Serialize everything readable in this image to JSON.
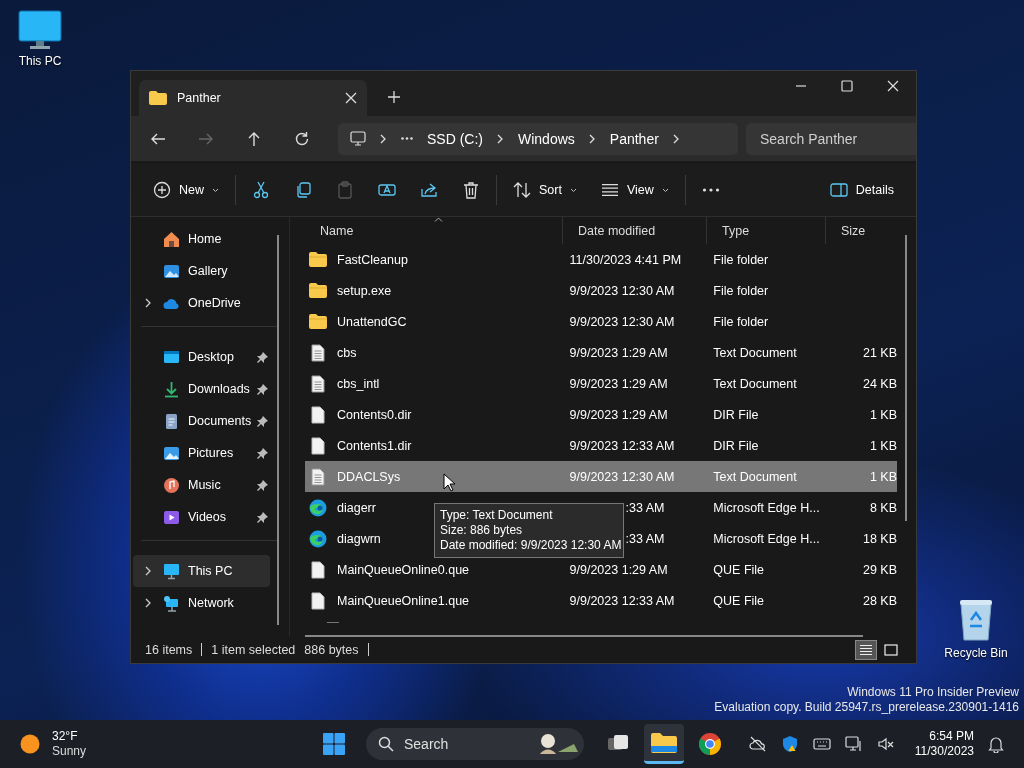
{
  "desktop_icons": [
    {
      "label": "This PC",
      "kind": "pc"
    },
    {
      "label": "Recycle Bin",
      "kind": "bin"
    }
  ],
  "window": {
    "tab": {
      "title": "Panther"
    },
    "nav": [
      {
        "kind": "back",
        "disabled": false
      },
      {
        "kind": "forward",
        "disabled": true
      },
      {
        "kind": "up",
        "disabled": false
      },
      {
        "kind": "refresh",
        "disabled": false
      }
    ],
    "breadcrumb": [
      "SSD (C:)",
      "Windows",
      "Panther"
    ],
    "search": {
      "placeholder": "Search Panther"
    },
    "toolbar": [
      {
        "kind": "new",
        "label": "New",
        "dropdown": true,
        "disabled": false
      },
      {
        "kind": "separator"
      },
      {
        "kind": "cut",
        "dropdown": false,
        "disabled": false
      },
      {
        "kind": "copy",
        "dropdown": false,
        "disabled": false
      },
      {
        "kind": "paste",
        "dropdown": false,
        "disabled": true
      },
      {
        "kind": "rename",
        "dropdown": false,
        "disabled": false
      },
      {
        "kind": "share",
        "dropdown": false,
        "disabled": false
      },
      {
        "kind": "delete",
        "dropdown": false,
        "disabled": false
      },
      {
        "kind": "separator"
      },
      {
        "kind": "sort",
        "label": "Sort",
        "dropdown": true,
        "disabled": false
      },
      {
        "kind": "view",
        "label": "View",
        "dropdown": true,
        "disabled": false
      },
      {
        "kind": "separator"
      },
      {
        "kind": "more",
        "dropdown": false,
        "disabled": false
      }
    ],
    "details_button": {
      "label": "Details"
    },
    "sidebar": [
      {
        "items": [
          {
            "label": "Home",
            "kind": "home",
            "expandable": false,
            "pinned": false,
            "selected": false
          },
          {
            "label": "Gallery",
            "kind": "gallery",
            "expandable": false,
            "pinned": false,
            "selected": false
          },
          {
            "label": "OneDrive",
            "kind": "cloud",
            "expandable": true,
            "pinned": false,
            "selected": false
          }
        ]
      },
      {
        "items": [
          {
            "label": "Desktop",
            "kind": "desktop",
            "expandable": false,
            "pinned": true,
            "selected": false
          },
          {
            "label": "Downloads",
            "kind": "downloads",
            "expandable": false,
            "pinned": true,
            "selected": false
          },
          {
            "label": "Documents",
            "kind": "documents",
            "expandable": false,
            "pinned": true,
            "selected": false
          },
          {
            "label": "Pictures",
            "kind": "pictures",
            "expandable": false,
            "pinned": true,
            "selected": false
          },
          {
            "label": "Music",
            "kind": "music",
            "expandable": false,
            "pinned": true,
            "selected": false
          },
          {
            "label": "Videos",
            "kind": "videos",
            "expandable": false,
            "pinned": true,
            "selected": false
          }
        ]
      },
      {
        "items": [
          {
            "label": "This PC",
            "kind": "pc",
            "expandable": true,
            "pinned": false,
            "selected": true
          },
          {
            "label": "Network",
            "kind": "network",
            "expandable": true,
            "pinned": false,
            "selected": false
          }
        ]
      }
    ],
    "columns": [
      {
        "label": "Name",
        "sorted": true
      },
      {
        "label": "Date modified",
        "sorted": false
      },
      {
        "label": "Type",
        "sorted": false
      },
      {
        "label": "Size",
        "sorted": false
      }
    ],
    "rows": [
      {
        "name": "FastCleanup",
        "date": "11/30/2023 4:41 PM",
        "type": "File folder",
        "kind": "folder",
        "selected": false
      },
      {
        "name": "setup.exe",
        "date": "9/9/2023 12:30 AM",
        "type": "File folder",
        "kind": "folder",
        "selected": false
      },
      {
        "name": "UnattendGC",
        "date": "9/9/2023 12:30 AM",
        "type": "File folder",
        "kind": "folder",
        "selected": false
      },
      {
        "name": "cbs",
        "date": "9/9/2023 1:29 AM",
        "type": "Text Document",
        "size": "21 KB",
        "kind": "text",
        "selected": false
      },
      {
        "name": "cbs_intl",
        "date": "9/9/2023 1:29 AM",
        "type": "Text Document",
        "size": "24 KB",
        "kind": "text",
        "selected": false
      },
      {
        "name": "Contents0.dir",
        "date": "9/9/2023 1:29 AM",
        "type": "DIR File",
        "size": "1 KB",
        "kind": "file",
        "selected": false
      },
      {
        "name": "Contents1.dir",
        "date": "9/9/2023 12:33 AM",
        "type": "DIR File",
        "size": "1 KB",
        "kind": "file",
        "selected": false
      },
      {
        "name": "DDACLSys",
        "date": "9/9/2023 12:30 AM",
        "type": "Text Document",
        "size": "1 KB",
        "kind": "text",
        "selected": true
      },
      {
        "name": "diagerr",
        "date": ":33 AM",
        "type": "Microsoft Edge H...",
        "size": "8 KB",
        "kind": "edge",
        "selected": false
      },
      {
        "name": "diagwrn",
        "date": ":33 AM",
        "type": "Microsoft Edge H...",
        "size": "18 KB",
        "kind": "edge",
        "selected": false
      },
      {
        "name": "MainQueueOnline0.que",
        "date": "9/9/2023 1:29 AM",
        "type": "QUE File",
        "size": "29 KB",
        "kind": "file",
        "selected": false
      },
      {
        "name": "MainQueueOnline1.que",
        "date": "9/9/2023 12:33 AM",
        "type": "QUE File",
        "size": "28 KB",
        "kind": "file",
        "selected": false
      }
    ],
    "tooltip": [
      "Type: Text Document",
      "Size: 886 bytes",
      "Date modified: 9/9/2023 12:30 AM"
    ],
    "status_bar": {
      "item_count": "16 items",
      "selection": "1 item selected",
      "selection_size": "886 bytes"
    },
    "view_modes": [
      {
        "kind": "details",
        "selected": true
      },
      {
        "kind": "tiles",
        "selected": false
      }
    ]
  },
  "os_notice": [
    "Windows 11 Pro Insider Preview",
    "Evaluation copy. Build 25947.rs_prerelease.230901-1416"
  ],
  "taskbar": {
    "weather": {
      "temperature": "32°F",
      "condition": "Sunny"
    },
    "search": {
      "placeholder": "Search"
    },
    "apps": [
      {
        "kind": "task-view",
        "active": false
      },
      {
        "kind": "explorer",
        "active": true
      },
      {
        "kind": "chrome",
        "active": false
      }
    ],
    "tray": [
      {
        "kind": "cloud-off"
      },
      {
        "kind": "shield"
      },
      {
        "kind": "keyboard"
      },
      {
        "kind": "network"
      },
      {
        "kind": "volume-muted"
      }
    ],
    "time": "6:54 PM",
    "date": "11/30/2023"
  }
}
